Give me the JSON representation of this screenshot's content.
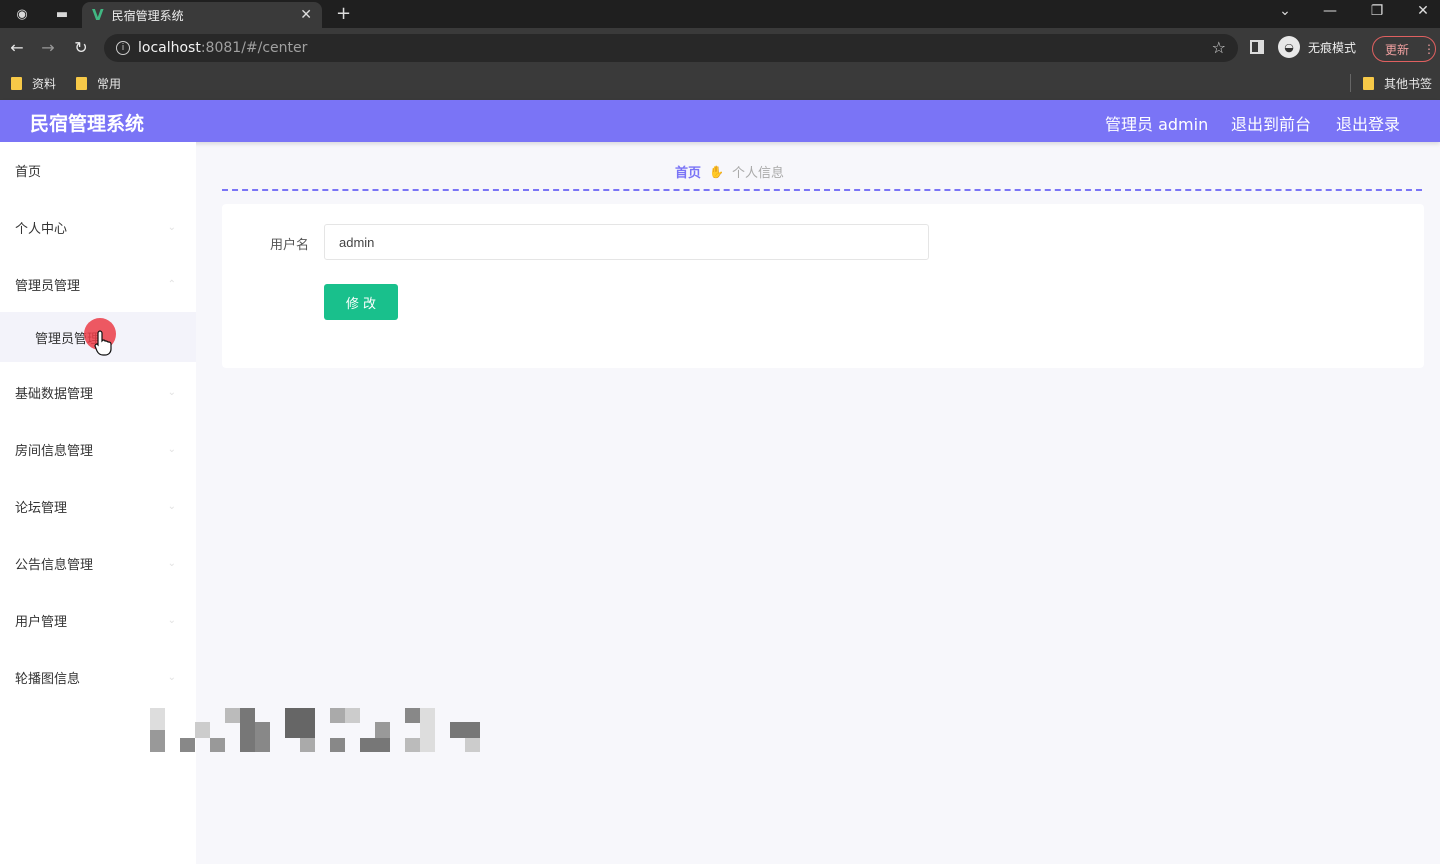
{
  "browser": {
    "tab_title": "民宿管理系统",
    "url_host": "localhost",
    "url_rest": ":8081/#/center",
    "incognito_label": "无痕模式",
    "update_label": "更新",
    "bookmarks": [
      "资料",
      "常用"
    ],
    "other_bookmarks": "其他书签"
  },
  "header": {
    "title": "民宿管理系统",
    "user": "管理员 admin",
    "back_to_front": "退出到前台",
    "logout": "退出登录"
  },
  "sidebar": {
    "items": [
      {
        "label": "首页"
      },
      {
        "label": "个人中心"
      },
      {
        "label": "管理员管理"
      },
      {
        "label": "基础数据管理"
      },
      {
        "label": "房间信息管理"
      },
      {
        "label": "论坛管理"
      },
      {
        "label": "公告信息管理"
      },
      {
        "label": "用户管理"
      },
      {
        "label": "轮播图信息"
      }
    ],
    "submenu": {
      "label": "管理员管理"
    }
  },
  "breadcrumb": {
    "home": "首页",
    "current": "个人信息"
  },
  "form": {
    "username_label": "用户名",
    "username_value": "admin",
    "submit_label": "修 改"
  },
  "colors": {
    "accent": "#7a74f6",
    "button": "#19c08c"
  }
}
